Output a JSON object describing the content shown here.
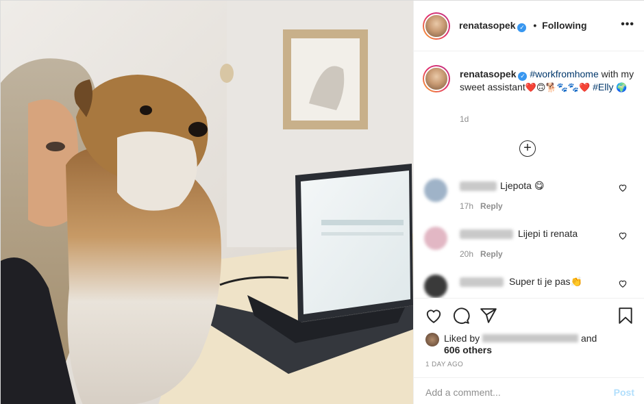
{
  "header": {
    "username": "renatasopek",
    "separator": "•",
    "follow_status": "Following",
    "more_label": "•••"
  },
  "caption": {
    "username": "renatasopek",
    "hashtag1": "#workfromhome",
    "text": " with my sweet assistant",
    "emojis": "❤️🙃🐕🐾🐾❤️",
    "hashtag2": "#Elly",
    "trailing_emoji": "🌍",
    "time": "1d"
  },
  "comments": [
    {
      "text": "Ljepota 😋",
      "time": "17h",
      "reply": "Reply"
    },
    {
      "text": "Lijepi ti renata",
      "time": "20h",
      "reply": "Reply"
    },
    {
      "text": "Super ti je pas👏",
      "time": "",
      "reply": ""
    }
  ],
  "likes": {
    "prefix": "Liked by",
    "and": "and",
    "others": "606 others"
  },
  "date": "1 DAY AGO",
  "comment_input": {
    "placeholder": "Add a comment..."
  },
  "post_label": "Post",
  "icons": {
    "like": "heart-outline-icon",
    "comment": "speech-bubble-icon",
    "share": "paper-plane-icon",
    "save": "bookmark-icon",
    "load_more": "plus-circle-icon"
  },
  "colors": {
    "link": "#00376b",
    "verified": "#3897f0",
    "muted": "#8e8e8e",
    "post_disabled": "#b2dffc"
  }
}
